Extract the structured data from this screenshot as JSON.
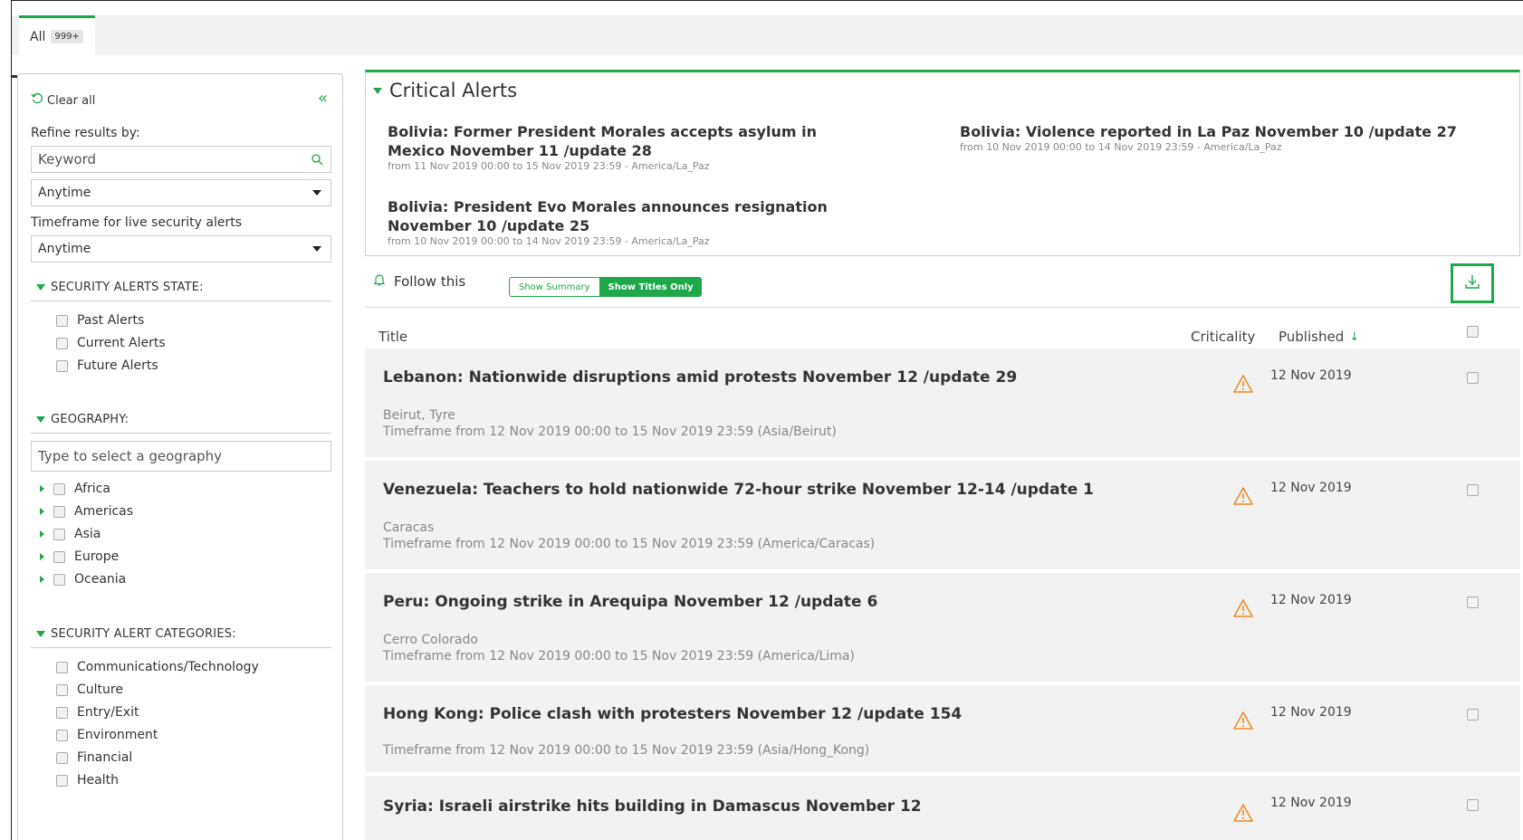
{
  "tabs": [
    {
      "label": "All",
      "count": "999+"
    }
  ],
  "sidebar": {
    "clear_all": "Clear all",
    "refine_label": "Refine results by:",
    "keyword_placeholder": "Keyword",
    "time_select": "Anytime",
    "timeframe_label": "Timeframe for live security alerts",
    "timeframe_select": "Anytime",
    "state_heading": "SECURITY ALERTS STATE:",
    "state_items": [
      "Past Alerts",
      "Current Alerts",
      "Future Alerts"
    ],
    "geo_heading": "GEOGRAPHY:",
    "geo_placeholder": "Type to select a geography",
    "geo_items": [
      "Africa",
      "Americas",
      "Asia",
      "Europe",
      "Oceania"
    ],
    "cat_heading": "SECURITY ALERT CATEGORIES:",
    "cat_items": [
      "Communications/Technology",
      "Culture",
      "Entry/Exit",
      "Environment",
      "Financial",
      "Health"
    ]
  },
  "critical": {
    "heading": "Critical Alerts",
    "items": [
      {
        "title": "Bolivia: Former President Morales accepts asylum in Mexico November 11 /update 28",
        "sub": "from 11 Nov 2019 00:00 to 15 Nov 2019 23:59 - America/La_Paz"
      },
      {
        "title": "Bolivia: Violence reported in La Paz November 10 /update 27",
        "sub": "from 10 Nov 2019 00:00 to 14 Nov 2019 23:59 - America/La_Paz"
      },
      {
        "title": "Bolivia: President Evo Morales announces resignation November 10 /update 25",
        "sub": "from 10 Nov 2019 00:00 to 14 Nov 2019 23:59 - America/La_Paz"
      }
    ]
  },
  "toolbar": {
    "follow": "Follow this",
    "show_summary": "Show Summary",
    "show_titles": "Show Titles Only"
  },
  "columns": {
    "title": "Title",
    "criticality": "Criticality",
    "published": "Published"
  },
  "rows": [
    {
      "title": "Lebanon: Nationwide disruptions amid protests November 12 /update 29",
      "location": "Beirut, Tyre",
      "timeframe": "Timeframe from 12 Nov 2019 00:00 to 15 Nov 2019 23:59 (Asia/Beirut)",
      "date": "12 Nov 2019"
    },
    {
      "title": "Venezuela: Teachers to hold nationwide 72-hour strike November 12-14 /update 1",
      "location": "Caracas",
      "timeframe": "Timeframe from 12 Nov 2019 00:00 to 15 Nov 2019 23:59 (America/Caracas)",
      "date": "12 Nov 2019"
    },
    {
      "title": "Peru: Ongoing strike in Arequipa November 12 /update 6",
      "location": "Cerro Colorado",
      "timeframe": "Timeframe from 12 Nov 2019 00:00 to 15 Nov 2019 23:59 (America/Lima)",
      "date": "12 Nov 2019"
    },
    {
      "title": "Hong Kong: Police clash with protesters November 12 /update 154",
      "location": "",
      "timeframe": "Timeframe from 12 Nov 2019 00:00 to 15 Nov 2019 23:59 (Asia/Hong_Kong)",
      "date": "12 Nov 2019"
    },
    {
      "title": "Syria: Israeli airstrike hits building in Damascus November 12",
      "location": "",
      "timeframe": "",
      "date": "12 Nov 2019"
    }
  ],
  "colors": {
    "accent": "#1ea84a",
    "warning": "#f08a24"
  }
}
